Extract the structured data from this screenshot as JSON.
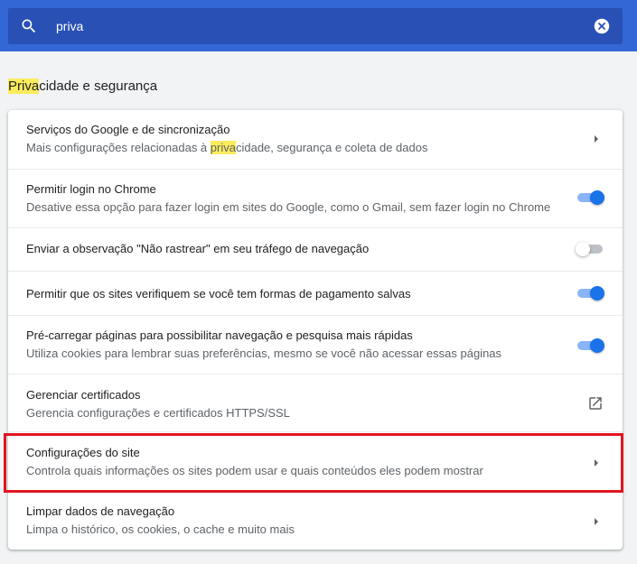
{
  "search": {
    "query": "priva",
    "icon": "search-icon",
    "clear_icon": "close-icon"
  },
  "section": {
    "title_highlight": "Priva",
    "title_rest": "cidade e segurança"
  },
  "rows": [
    {
      "title": "Serviços do Google e de sincronização",
      "subtitle_pre": "Mais configurações relacionadas à ",
      "subtitle_highlight": "priva",
      "subtitle_post": "cidade, segurança e coleta de dados",
      "control": "arrow"
    },
    {
      "title": "Permitir login no Chrome",
      "subtitle": "Desative essa opção para fazer login em sites do Google, como o Gmail, sem fazer login no Chrome",
      "control": "toggle",
      "enabled": true
    },
    {
      "title": "Enviar a observação \"Não rastrear\" em seu tráfego de navegação",
      "control": "toggle",
      "enabled": false
    },
    {
      "title": "Permitir que os sites verifiquem se você tem formas de pagamento salvas",
      "control": "toggle",
      "enabled": true
    },
    {
      "title": "Pré-carregar páginas para possibilitar navegação e pesquisa mais rápidas",
      "subtitle": "Utiliza cookies para lembrar suas preferências, mesmo se você não acessar essas páginas",
      "control": "toggle",
      "enabled": true
    },
    {
      "title": "Gerenciar certificados",
      "subtitle": "Gerencia configurações e certificados HTTPS/SSL",
      "control": "external-link"
    },
    {
      "title": "Configurações do site",
      "subtitle": "Controla quais informações os sites podem usar e quais conteúdos eles podem mostrar",
      "control": "arrow"
    },
    {
      "title": "Limpar dados de navegação",
      "subtitle": "Limpa o histórico, os cookies, o cache e muito mais",
      "control": "arrow"
    }
  ],
  "colors": {
    "header": "#3367d6",
    "search_box": "#2850b5",
    "toggle_on": "#1a73e8",
    "highlight": "#fbec5d",
    "callout_border": "#e0151f"
  }
}
